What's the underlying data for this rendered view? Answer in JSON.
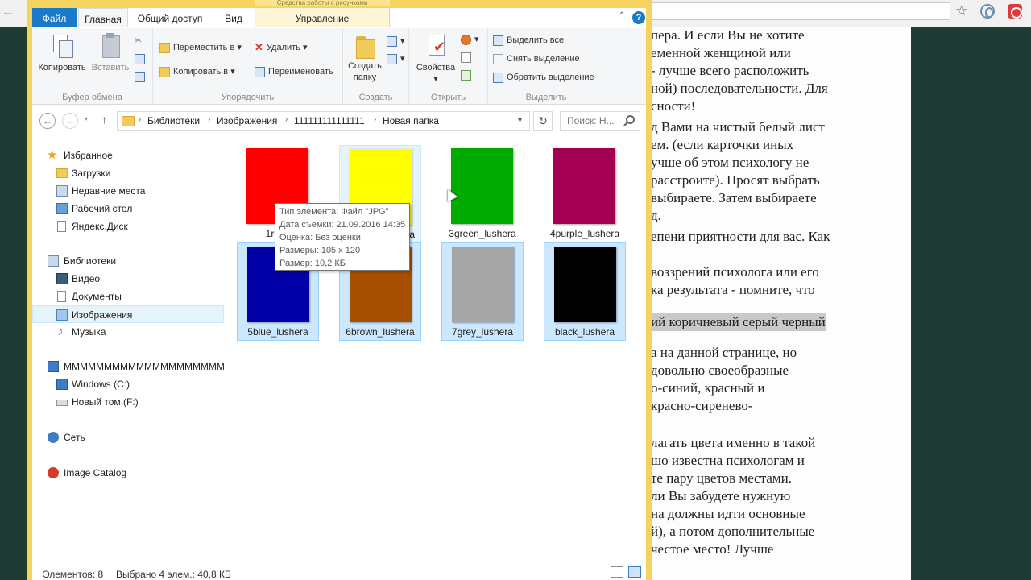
{
  "browser": {
    "article_lines": [
      "пера. И если Вы не хотите",
      "еменной женщиной или",
      "- лучше всего расположить",
      "ной) последовательности. Для",
      "сности!",
      "д Вами на чистый белый лист",
      "ем. (если карточки иных",
      "учше об этом психологу не",
      "расстроите). Просят выбрать",
      "выбираете. Затем выбираете",
      "д.",
      "епени приятности для вас. Как",
      "",
      "воззрений психолога или его",
      "ка результата - помните, что",
      "",
      "ий коричневый серый черный",
      "а на данной странице, но",
      "довольно своеобразные",
      "о-синий, красный и",
      "красно-сиренево-",
      "",
      "лагать цвета именно в такой",
      "шо известна психологам и",
      "те пару цветов местами.",
      "ли Вы забудете нужную",
      "на должны идти основные",
      "й), а потом дополнительные",
      "честое место! Лучше"
    ]
  },
  "explorer": {
    "context_title": "Средства работы с рисунками",
    "tabs": {
      "file": "Файл",
      "home": "Главная",
      "share": "Общий доступ",
      "view": "Вид",
      "manage": "Управление"
    },
    "help": "?",
    "ribbon": {
      "clipboard": {
        "label": "Буфер обмена",
        "copy": "Копировать",
        "paste": "Вставить"
      },
      "organize": {
        "label": "Упорядочить",
        "move": "Переместить в",
        "copy_to": "Копировать в",
        "delete": "Удалить",
        "rename": "Переименовать"
      },
      "create": {
        "label": "Создать",
        "new_folder_1": "Создать",
        "new_folder_2": "папку"
      },
      "open": {
        "label": "Открыть",
        "properties": "Свойства"
      },
      "select": {
        "label": "Выделить",
        "select_all": "Выделить все",
        "select_none": "Снять выделение",
        "invert": "Обратить выделение"
      }
    },
    "address": {
      "crumbs": [
        "Библиотеки",
        "Изображения",
        "111111111111111",
        "Новая папка"
      ],
      "search_placeholder": "Поиск: Н..."
    },
    "nav": {
      "favorites": "Избранное",
      "downloads": "Загрузки",
      "recent": "Недавние места",
      "desktop": "Рабочий стол",
      "yadisk": "Яндекс.Диск",
      "libraries": "Библиотеки",
      "video": "Видео",
      "documents": "Документы",
      "images": "Изображения",
      "music": "Музыка",
      "computer": "MMMMMMMMMMMMMMMMMMMM",
      "drive_c": "Windows (C:)",
      "drive_f": "Новый том (F:)",
      "network": "Сеть",
      "image_catalog": "Image Catalog"
    },
    "files": [
      {
        "name": "1red_",
        "color": "#ff0000",
        "state": "normal"
      },
      {
        "name": "2yellow_lushera",
        "color": "#ffff00",
        "state": "hover"
      },
      {
        "name": "3green_lushera",
        "color": "#00aa00",
        "state": "normal"
      },
      {
        "name": "4purple_lushera",
        "color": "#a30052",
        "state": "normal"
      },
      {
        "name": "5blue_lushera",
        "color": "#0000a6",
        "state": "selected"
      },
      {
        "name": "6brown_lushera",
        "color": "#a64f00",
        "state": "selected"
      },
      {
        "name": "7grey_lushera",
        "color": "#a6a6a6",
        "state": "selected"
      },
      {
        "name": "black_lushera",
        "color": "#000000",
        "state": "selected"
      }
    ],
    "tooltip": {
      "type": "Тип элемента: Файл \"JPG\"",
      "date": "Дата съемки: 21.09.2016 14:35",
      "rating": "Оценка: Без оценки",
      "dimensions": "Размеры: 105 x 120",
      "size": "Размер: 10,2 КБ"
    },
    "status": {
      "count": "Элементов: 8",
      "selected": "Выбрано 4 элем.: 40,8 КБ"
    }
  }
}
